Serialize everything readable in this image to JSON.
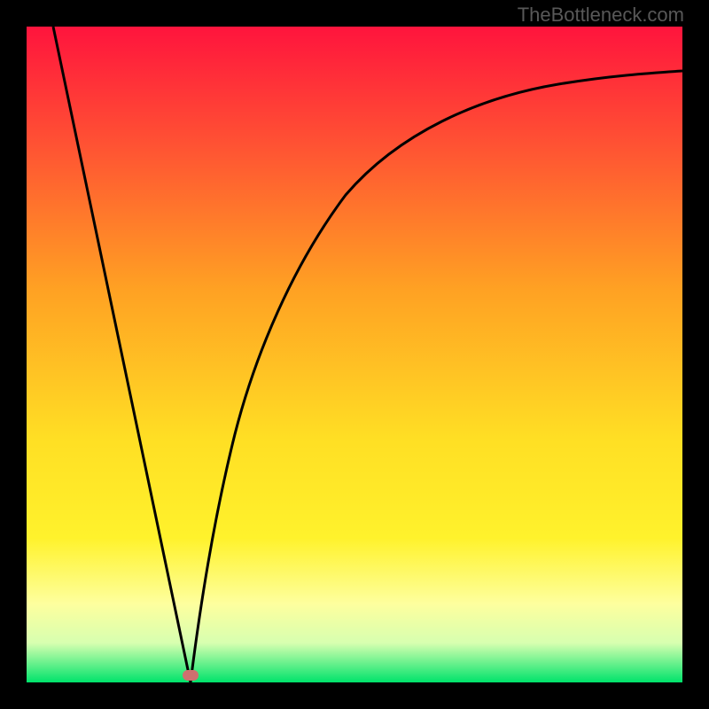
{
  "watermark": "TheBottleneck.com",
  "colors": {
    "black": "#000000",
    "curve": "#000000",
    "marker": "#cf6f6f",
    "gradient_top": "#ff143d",
    "gradient_upper": "#ff5a2e",
    "gradient_mid": "#ffa123",
    "gradient_lower": "#ffd726",
    "gradient_yellow": "#fff22c",
    "gradient_pale": "#feff9e",
    "gradient_bottom": "#00e36b"
  },
  "chart_data": {
    "type": "line",
    "title": "",
    "xlabel": "",
    "ylabel": "",
    "x_range": [
      0,
      100
    ],
    "y_range": [
      0,
      100
    ],
    "series": [
      {
        "name": "left-line",
        "x": [
          4,
          25
        ],
        "y": [
          100,
          0
        ]
      },
      {
        "name": "right-curve",
        "x": [
          25,
          27,
          30,
          34,
          40,
          48,
          58,
          70,
          84,
          100
        ],
        "y": [
          0,
          12,
          28,
          44,
          58,
          70,
          79,
          85,
          89,
          92
        ]
      }
    ],
    "marker": {
      "x": 25,
      "y": 0
    },
    "gradient_stops": [
      {
        "offset": 0,
        "color": "#ff143d"
      },
      {
        "offset": 18,
        "color": "#ff5233"
      },
      {
        "offset": 40,
        "color": "#ffa123"
      },
      {
        "offset": 63,
        "color": "#ffdf24"
      },
      {
        "offset": 78,
        "color": "#fff22c"
      },
      {
        "offset": 88,
        "color": "#feff9e"
      },
      {
        "offset": 94,
        "color": "#d7ffb0"
      },
      {
        "offset": 100,
        "color": "#00e36b"
      }
    ]
  }
}
